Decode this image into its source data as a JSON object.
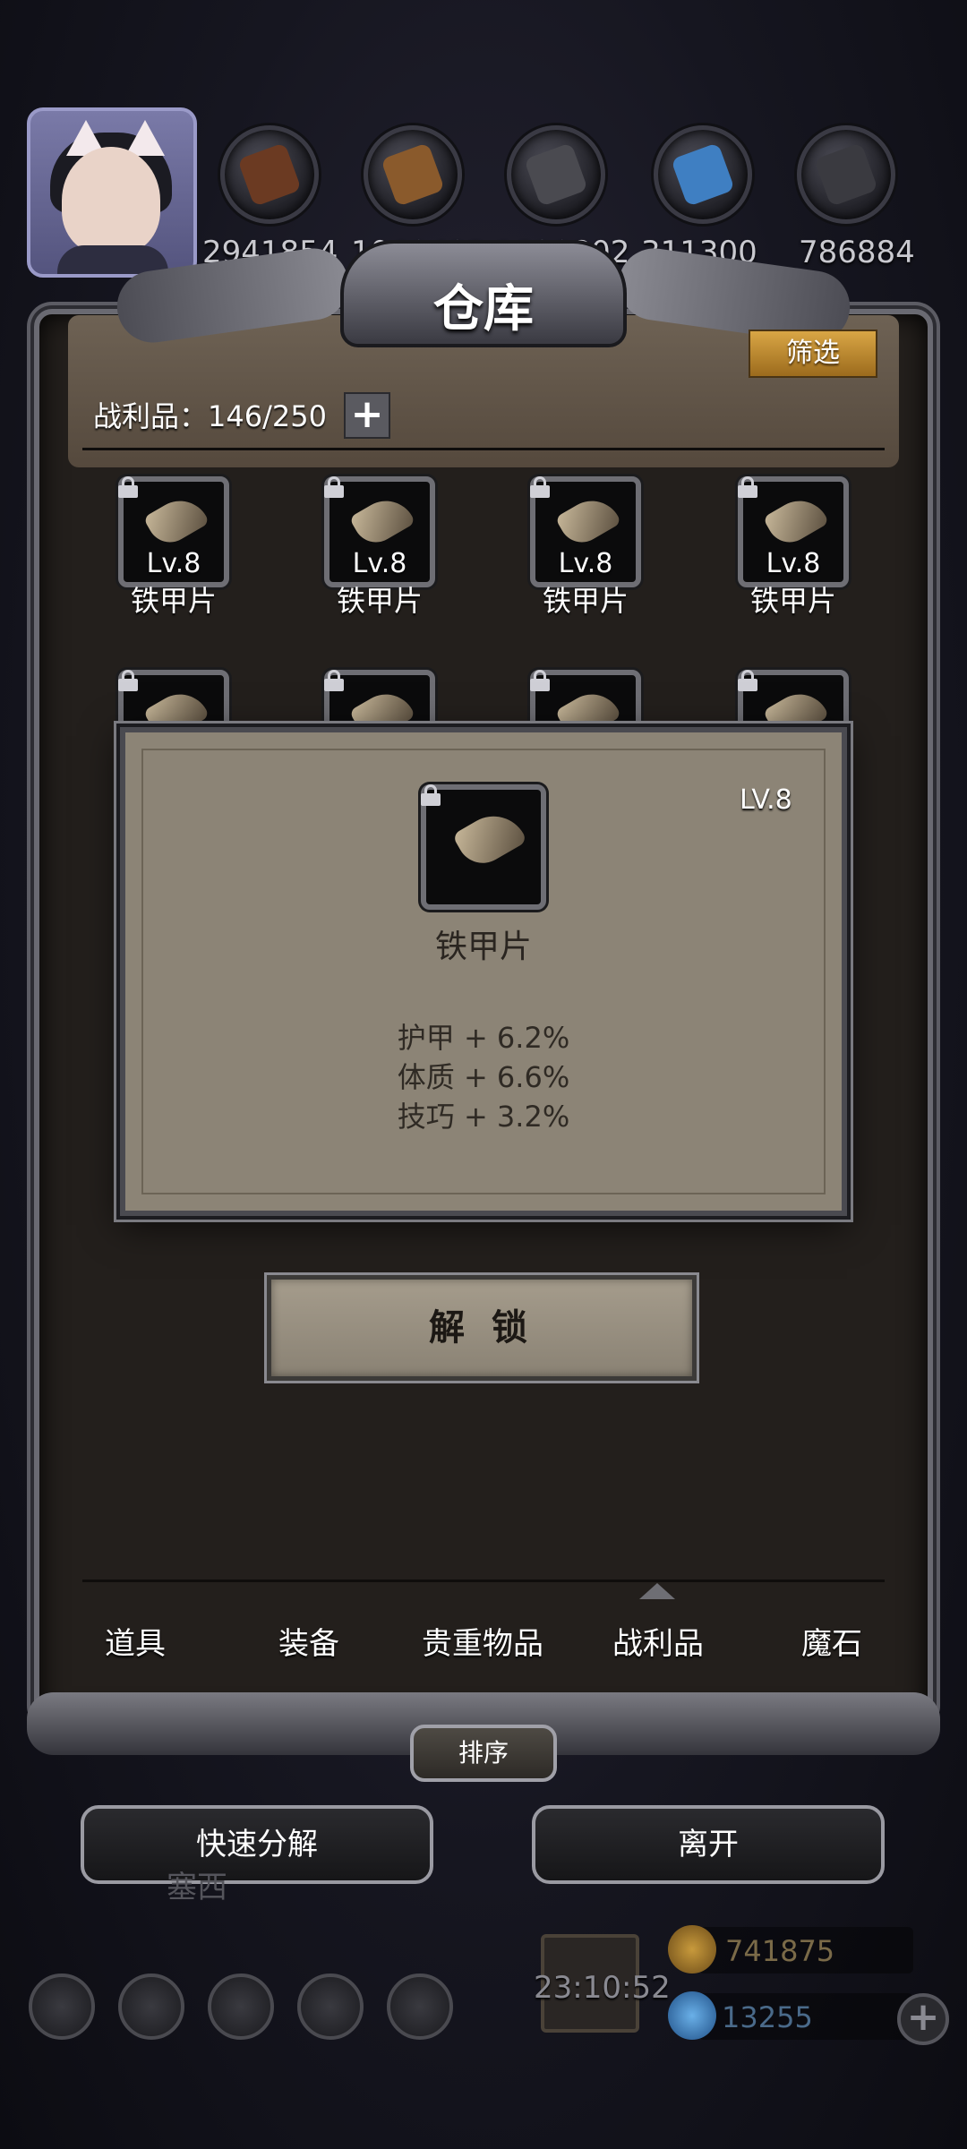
{
  "resources": {
    "items": [
      {
        "icon": "wood-log-icon",
        "color": "#6b3a22",
        "value": "2941854"
      },
      {
        "icon": "plank-icon",
        "color": "#8a5a2c",
        "value": "1060403"
      },
      {
        "icon": "iron-ingot-icon",
        "color": "#4a4a50",
        "value": "1690802"
      },
      {
        "icon": "crystal-icon",
        "color": "#3f7fc2",
        "value": "311300"
      },
      {
        "icon": "stone-icon",
        "color": "#3a3a40",
        "value": "786884"
      }
    ]
  },
  "panel": {
    "title": "仓库",
    "filter_label": "筛选",
    "loot_label": "战利品：146/250",
    "add_label": "+"
  },
  "items": [
    {
      "level": "Lv.8",
      "name": "铁甲片"
    },
    {
      "level": "Lv.8",
      "name": "铁甲片"
    },
    {
      "level": "Lv.8",
      "name": "铁甲片"
    },
    {
      "level": "Lv.8",
      "name": "铁甲片"
    }
  ],
  "popup": {
    "level": "LV.8",
    "name": "铁甲片",
    "stats": [
      "护甲 + 6.2%",
      "体质 + 6.6%",
      "技巧 + 3.2%"
    ],
    "unlock_label": "解 锁"
  },
  "tabs": [
    "道具",
    "装备",
    "贵重物品",
    "战利品",
    "魔石"
  ],
  "active_tab": "战利品",
  "sort_label": "排序",
  "actions": {
    "quick_decompose": "快速分解",
    "leave": "离开"
  },
  "background": {
    "hidden_label": "塞西",
    "timer": "23:10:52",
    "gold": "741875",
    "diamonds": "13255"
  },
  "colors": {
    "accent_gold": "#d9a645",
    "panel": "#231f1c",
    "popup": "#8c8476"
  }
}
